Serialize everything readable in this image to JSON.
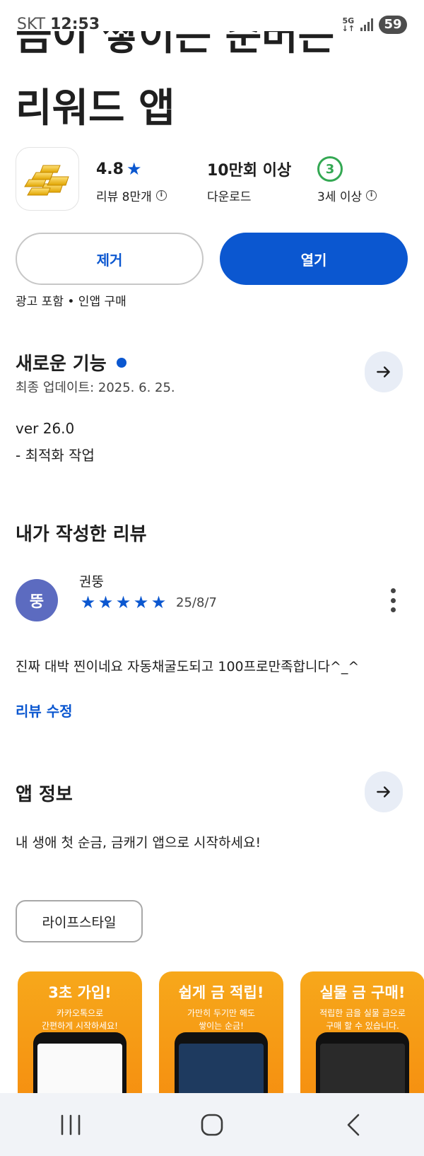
{
  "status_bar": {
    "carrier": "SKT",
    "time": "12:53",
    "network": "5G",
    "battery": "59"
  },
  "app": {
    "title_line1": "금이 쌓이는 순버는",
    "title_line2": "리워드 앱",
    "rating": "4.8",
    "reviews_label": "리뷰 8만개",
    "downloads": "10만회 이상",
    "downloads_label": "다운로드",
    "age_rating": "3",
    "age_label": "3세 이상",
    "icon": "gold-bars-icon"
  },
  "actions": {
    "remove_label": "제거",
    "open_label": "열기",
    "ads_note": "광고 포함 • 인앱 구매"
  },
  "whats_new": {
    "title": "새로운 기능",
    "updated": "최종 업데이트: 2025. 6. 25.",
    "version": "ver 26.0",
    "notes": "- 최적화 작업"
  },
  "my_review": {
    "title": "내가 작성한 리뷰",
    "reviewer_name": "권뚱",
    "avatar_letter": "뚱",
    "stars": 5,
    "date": "25/8/7",
    "text": "진짜 대박 찐이네요 자동채굴도되고 100프로만족합니다^_^",
    "edit_label": "리뷰 수정"
  },
  "about": {
    "title": "앱 정보",
    "description": "내 생애 첫 순금, 금캐기 앱으로 시작하세요!",
    "category": "라이프스타일"
  },
  "screenshots": [
    {
      "heading": "3초 가입!",
      "sub1": "카카오톡으로",
      "sub2": "간편하게 시작하세요!"
    },
    {
      "heading": "쉽게 금 적립!",
      "sub1": "가만히 두기만 해도",
      "sub2": "쌓이는 순금!"
    },
    {
      "heading": "실물 금 구매!",
      "sub1": "적립한 금을 실물 금으로",
      "sub2": "구매 할 수 있습니다."
    }
  ],
  "colors": {
    "accent": "#0b57d0",
    "age_badge": "#34a853",
    "avatar": "#5c6bc0",
    "screenshot_bg": "#f7a81b"
  }
}
